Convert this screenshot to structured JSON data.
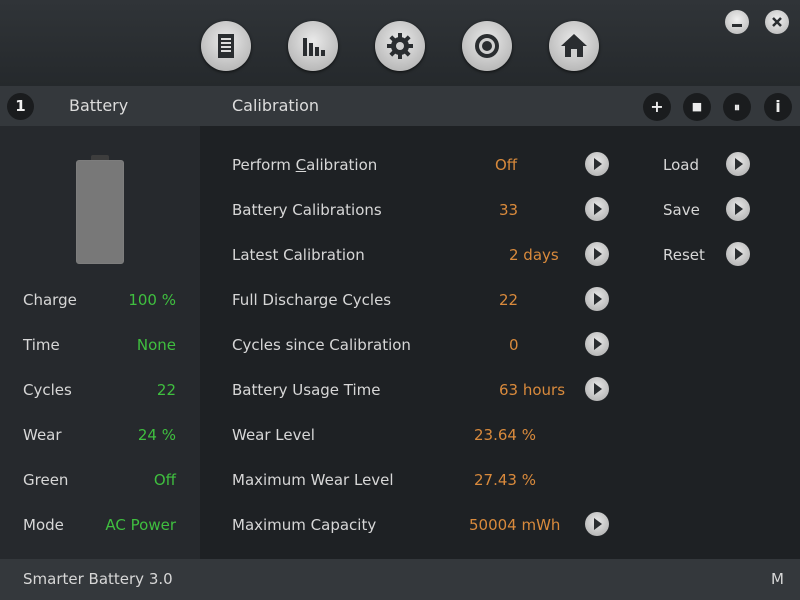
{
  "toolbar": {
    "icons": [
      "document-icon",
      "bar-chart-icon",
      "gear-icon",
      "target-icon",
      "home-icon"
    ],
    "window_buttons": [
      "minimize-icon",
      "close-icon"
    ]
  },
  "header": {
    "badge": "1",
    "left_title": "Battery",
    "main_title": "Calibration",
    "tools": {
      "add": "+",
      "stop": "■",
      "pause": "⏸",
      "info": "i"
    }
  },
  "battery_panel": {
    "rows": [
      {
        "label": "Charge",
        "value": "100 %"
      },
      {
        "label": "Time",
        "value": "None"
      },
      {
        "label": "Cycles",
        "value": "22"
      },
      {
        "label": "Wear",
        "value": "24 %"
      },
      {
        "label": "Green",
        "value": "Off"
      },
      {
        "label": "Mode",
        "value": "AC Power"
      }
    ]
  },
  "calibration": {
    "perform": {
      "label_pre": "Perform ",
      "label_ul": "C",
      "label_post": "alibration",
      "value": "Off"
    },
    "rows": [
      {
        "label": "Battery Calibrations",
        "value": "33"
      },
      {
        "label": "Latest Calibration",
        "value": "2 days"
      },
      {
        "label": "Full Discharge Cycles",
        "value": "22"
      },
      {
        "label": "Cycles since Calibration",
        "value": "0"
      },
      {
        "label": "Battery Usage Time",
        "value": "63 hours"
      },
      {
        "label": "Wear Level",
        "value": "23.64 %"
      },
      {
        "label": "Maximum Wear Level",
        "value": "27.43 %"
      },
      {
        "label": "Maximum Capacity",
        "value": "50004 mWh"
      }
    ]
  },
  "actions": {
    "load": "Load",
    "save": "Save",
    "reset": "Reset"
  },
  "status": {
    "app_name": "Smarter Battery 3.0",
    "right": "M"
  },
  "colors": {
    "value_green": "#3fbf3f",
    "value_orange": "#d98a3c",
    "background": "#1e2124"
  }
}
